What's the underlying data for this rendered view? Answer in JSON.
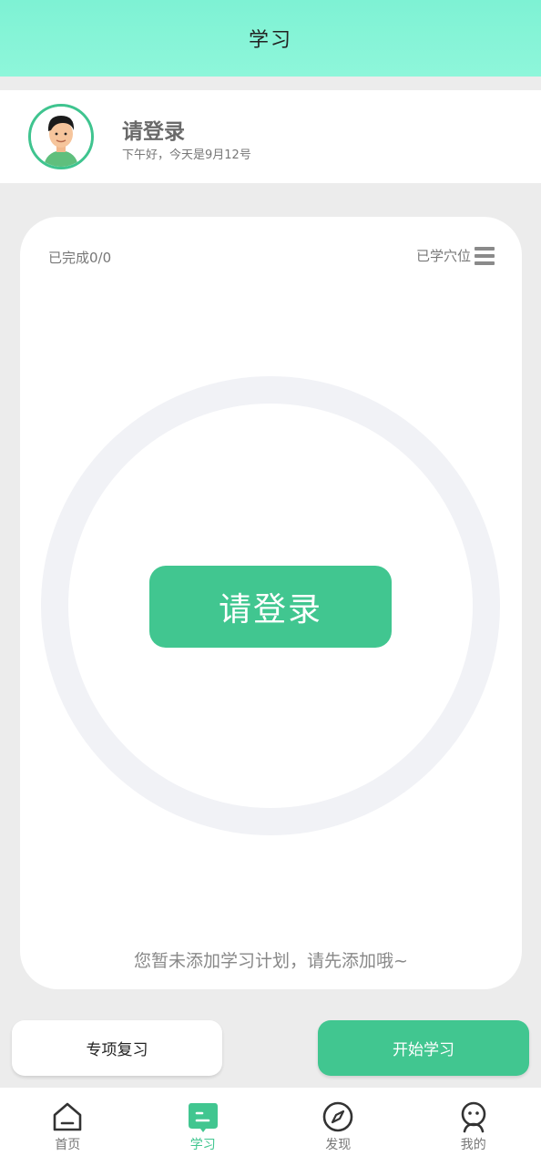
{
  "header": {
    "title": "学习"
  },
  "profile": {
    "name": "请登录",
    "greeting": "下午好，今天是9月12号"
  },
  "card": {
    "progress": "已完成0/0",
    "learned_label": "已学穴位",
    "login_button": "请登录",
    "empty_tip": "您暂未添加学习计划，请先添加哦~"
  },
  "actions": {
    "review": "专项复习",
    "start": "开始学习"
  },
  "tabs": [
    {
      "label": "首页",
      "icon": "home-icon"
    },
    {
      "label": "学习",
      "icon": "study-icon"
    },
    {
      "label": "发现",
      "icon": "compass-icon"
    },
    {
      "label": "我的",
      "icon": "profile-icon"
    }
  ],
  "colors": {
    "accent": "#41c690",
    "header_top": "#7ef2d4",
    "ring": "#f1f2f6"
  }
}
